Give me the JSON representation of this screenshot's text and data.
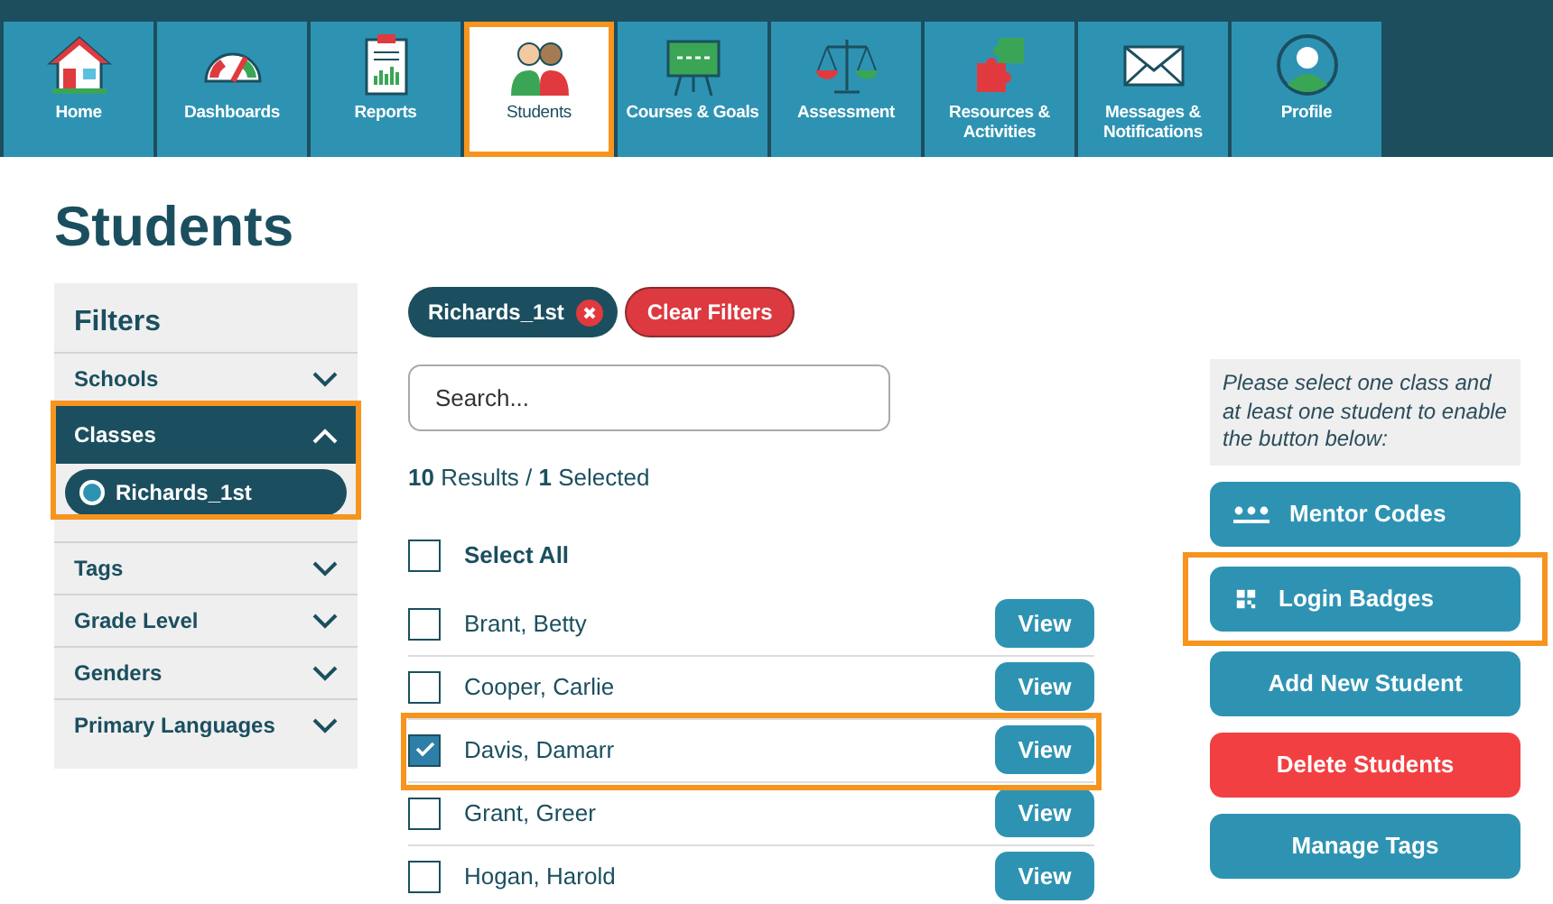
{
  "nav": [
    {
      "label": "Home",
      "kind": "home",
      "selected": false,
      "highlighted": false
    },
    {
      "label": "Dashboards",
      "kind": "gauge",
      "selected": false,
      "highlighted": false
    },
    {
      "label": "Reports",
      "kind": "report",
      "selected": false,
      "highlighted": false
    },
    {
      "label": "Students",
      "kind": "students",
      "selected": true,
      "highlighted": true
    },
    {
      "label": "Courses & Goals",
      "kind": "easel",
      "selected": false,
      "highlighted": false
    },
    {
      "label": "Assessment",
      "kind": "scale",
      "selected": false,
      "highlighted": false
    },
    {
      "label": "Resources & Activities",
      "kind": "puzzle",
      "selected": false,
      "highlighted": false
    },
    {
      "label": "Messages & Notifications",
      "kind": "envelope",
      "selected": false,
      "highlighted": false
    },
    {
      "label": "Profile",
      "kind": "profile",
      "selected": false,
      "highlighted": false
    }
  ],
  "page_title": "Students",
  "filters": {
    "title": "Filters",
    "groups": [
      {
        "label": "Schools",
        "expanded": false,
        "highlighted": false
      },
      {
        "label": "Classes",
        "expanded": true,
        "highlighted": true,
        "options": [
          {
            "label": "Richards_1st",
            "selected": true
          }
        ]
      },
      {
        "label": "Tags",
        "expanded": false,
        "highlighted": false
      },
      {
        "label": "Grade Level",
        "expanded": false,
        "highlighted": false
      },
      {
        "label": "Genders",
        "expanded": false,
        "highlighted": false
      },
      {
        "label": "Primary Languages",
        "expanded": false,
        "highlighted": false
      }
    ]
  },
  "active_filters": [
    {
      "label": "Richards_1st"
    }
  ],
  "clear_filters": "Clear Filters",
  "search": {
    "placeholder": "Search..."
  },
  "results_summary": "**10** Results / **1** Selected",
  "select_all": {
    "label": "Select All",
    "checked": false
  },
  "students": [
    {
      "name": "Brant, Betty",
      "checked": false,
      "highlighted": false,
      "action": "View"
    },
    {
      "name": "Cooper, Carlie",
      "checked": false,
      "highlighted": false,
      "action": "View"
    },
    {
      "name": "Davis, Damarr",
      "checked": true,
      "highlighted": true,
      "action": "View"
    },
    {
      "name": "Grant, Greer",
      "checked": false,
      "highlighted": false,
      "action": "View"
    },
    {
      "name": "Hogan, Harold",
      "checked": false,
      "highlighted": false,
      "action": "View"
    }
  ],
  "note": "Please select one class and at least one student to enable the button below:",
  "actions": [
    {
      "label": "Mentor Codes",
      "kind": "mentor",
      "highlighted": false
    },
    {
      "label": "Login Badges",
      "kind": "badges",
      "highlighted": true
    },
    {
      "label": "Add New Student",
      "kind": "plain",
      "highlighted": false
    },
    {
      "label": "Delete Students",
      "kind": "danger",
      "highlighted": false
    },
    {
      "label": "Manage Tags",
      "kind": "plain",
      "highlighted": false
    }
  ]
}
